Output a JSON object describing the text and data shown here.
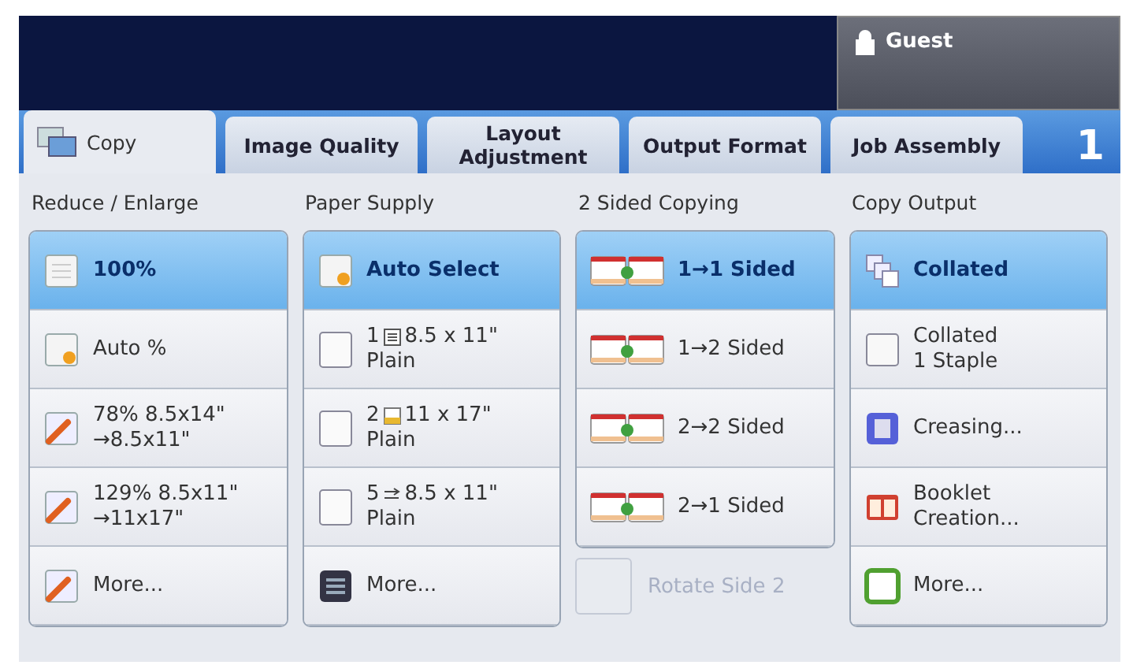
{
  "header": {
    "user": "Guest"
  },
  "tabs": [
    {
      "label": "Copy",
      "selected": true,
      "icon": true
    },
    {
      "label": "Image Quality",
      "selected": false
    },
    {
      "label": "Layout Adjustment",
      "selected": false
    },
    {
      "label": "Output Format",
      "selected": false
    },
    {
      "label": "Job Assembly",
      "selected": false
    }
  ],
  "page_number": "1",
  "columns": [
    {
      "title": "Reduce / Enlarge",
      "options": [
        {
          "kind": "page",
          "lines": [
            "100%"
          ],
          "selected": true
        },
        {
          "kind": "auto",
          "lines": [
            "Auto %"
          ],
          "selected": false
        },
        {
          "kind": "wrench",
          "lines": [
            "78% 8.5x14\"",
            "→8.5x11\""
          ],
          "selected": false
        },
        {
          "kind": "wrench",
          "lines": [
            "129% 8.5x11\"",
            "→11x17\""
          ],
          "selected": false
        },
        {
          "kind": "wrench",
          "lines": [
            "More..."
          ],
          "selected": false
        }
      ]
    },
    {
      "title": "Paper Supply",
      "options": [
        {
          "kind": "auto",
          "lines": [
            "Auto Select"
          ],
          "selected": true
        },
        {
          "kind": "tray",
          "tray_number": "1",
          "tray": {
            "kind": "stack"
          },
          "lines": [
            "8.5 x 11\"",
            "Plain"
          ],
          "selected": false
        },
        {
          "kind": "tray",
          "tray_number": "2",
          "tray": {
            "kind": "large"
          },
          "lines": [
            "11 x 17\"",
            "Plain"
          ],
          "selected": false
        },
        {
          "kind": "tray",
          "tray_number": "5",
          "tray": {
            "kind": "bypass"
          },
          "lines": [
            "8.5 x 11\"",
            "Plain"
          ],
          "selected": false
        },
        {
          "kind": "menu",
          "lines": [
            "More..."
          ],
          "selected": false
        }
      ]
    },
    {
      "title": "2 Sided Copying",
      "options": [
        {
          "kind": "duplex",
          "lines": [
            "1→1 Sided"
          ],
          "selected": true
        },
        {
          "kind": "duplex",
          "lines": [
            "1→2 Sided"
          ],
          "selected": false
        },
        {
          "kind": "duplex",
          "lines": [
            "2→2 Sided"
          ],
          "selected": false
        },
        {
          "kind": "duplex",
          "lines": [
            "2→1 Sided"
          ],
          "selected": false
        }
      ],
      "checkbox": {
        "label": "Rotate Side 2",
        "checked": false,
        "disabled": true
      }
    },
    {
      "title": "Copy Output",
      "options": [
        {
          "kind": "collate",
          "lines": [
            "Collated"
          ],
          "selected": true
        },
        {
          "kind": "staple",
          "lines": [
            "Collated",
            "1 Staple"
          ],
          "selected": false
        },
        {
          "kind": "crease",
          "lines": [
            "Creasing..."
          ],
          "selected": false
        },
        {
          "kind": "booklet",
          "lines": [
            "Booklet",
            "Creation..."
          ],
          "selected": false
        },
        {
          "kind": "green",
          "lines": [
            "More..."
          ],
          "selected": false
        }
      ]
    }
  ]
}
